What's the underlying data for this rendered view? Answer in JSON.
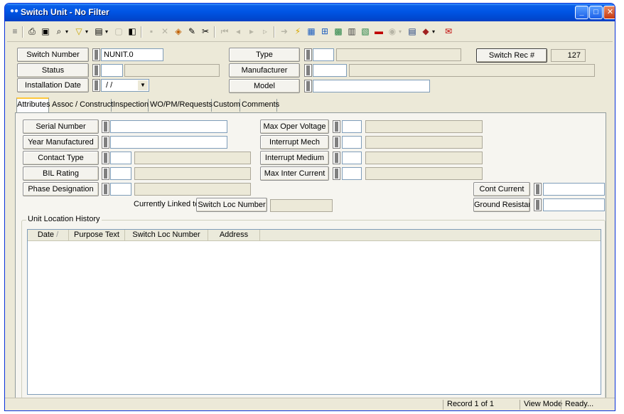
{
  "window": {
    "title": "Switch Unit - No Filter",
    "minimize_label": "_",
    "maximize_label": "□",
    "close_label": "✕"
  },
  "toolbar": {
    "icons": [
      "new-record-icon",
      "print-icon",
      "preview-icon",
      "search-icon",
      "filter-icon",
      "view-icon",
      "disabled-copy-icon",
      "copy-icon",
      "save-icon",
      "delete-icon",
      "color-icon",
      "edit-pencil-icon",
      "cut-icon",
      "first-record-icon",
      "prev-page-icon",
      "prev-record-icon",
      "next-record-icon",
      "next-page-icon",
      "last-record-icon",
      "lightning-icon",
      "map-icon",
      "tree-icon",
      "report-icon",
      "calendar-icon",
      "chart-icon",
      "battery-icon",
      "globe-icon",
      "list-icon",
      "book-icon",
      "mail-icon"
    ]
  },
  "header": {
    "switch_number_label": "Switch Number",
    "switch_number_value": "NUNIT.0",
    "status_label": "Status",
    "status_value": "",
    "installation_date_label": "Installation Date",
    "installation_date_value": "/ /",
    "type_label": "Type",
    "manufacturer_label": "Manufacturer",
    "model_label": "Model",
    "switch_rec_label": "Switch Rec #",
    "switch_rec_value": "127"
  },
  "tabs": [
    {
      "label": "Attributes",
      "active": true
    },
    {
      "label": "Assoc / Construct",
      "active": false
    },
    {
      "label": "Inspection",
      "active": false
    },
    {
      "label": "WO/PM/Requests",
      "active": false
    },
    {
      "label": "Custom",
      "active": false
    },
    {
      "label": "Comments",
      "active": false
    }
  ],
  "attributes": {
    "serial_number_label": "Serial Number",
    "year_manufactured_label": "Year Manufactured",
    "contact_type_label": "Contact Type",
    "bil_rating_label": "BIL Rating",
    "phase_designation_label": "Phase Designation",
    "max_oper_voltage_label": "Max Oper Voltage",
    "interrupt_mech_label": "Interrupt Mech",
    "interrupt_medium_label": "Interrupt Medium",
    "max_inter_current_label": "Max Inter Current",
    "cont_current_label": "Cont Current",
    "ground_resistance_label": "Ground Resistance",
    "currently_linked_label": "Currently Linked to",
    "switch_loc_number_label": "Switch Loc Number"
  },
  "history": {
    "title": "Unit Location History",
    "columns": [
      "Date",
      "Purpose Text",
      "Switch Loc Number",
      "Address"
    ],
    "sort_indicator": "/",
    "rows": []
  },
  "status": {
    "record": "Record 1 of 1",
    "mode": "View Mode",
    "state": "Ready..."
  }
}
